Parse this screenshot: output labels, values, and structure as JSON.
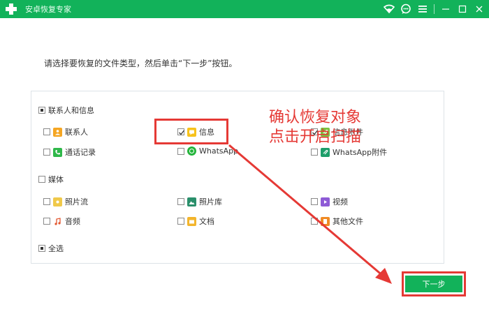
{
  "window": {
    "title": "安卓恢复专家",
    "icons": [
      "wifi-icon",
      "chat-icon",
      "menu-icon",
      "minimize-icon",
      "maximize-icon",
      "close-icon"
    ]
  },
  "instruction": "请选择要恢复的文件类型，然后单击“下一步”按钮。",
  "categories": {
    "contacts_messages": {
      "label": "联系人和信息",
      "state": "partial",
      "items": {
        "contacts": {
          "label": "联系人",
          "checked": false,
          "icon": "contacts-icon"
        },
        "messages": {
          "label": "信息",
          "checked": true,
          "icon": "message-icon"
        },
        "message_attachments": {
          "label": "信息附件",
          "checked": true,
          "icon": "attachment-icon"
        },
        "call_log": {
          "label": "通话记录",
          "checked": false,
          "icon": "phone-icon"
        },
        "whatsapp": {
          "label": "WhatsApp",
          "checked": false,
          "icon": "whatsapp-icon"
        },
        "whatsapp_attachments": {
          "label": "WhatsApp附件",
          "checked": false,
          "icon": "whatsapp-attachment-icon"
        }
      }
    },
    "media": {
      "label": "媒体",
      "state": "unchecked",
      "items": {
        "photo_stream": {
          "label": "照片流",
          "checked": false,
          "icon": "photo-stream-icon"
        },
        "photo_library": {
          "label": "照片库",
          "checked": false,
          "icon": "photo-library-icon"
        },
        "video": {
          "label": "视频",
          "checked": false,
          "icon": "video-icon"
        },
        "audio": {
          "label": "音频",
          "checked": false,
          "icon": "audio-icon"
        },
        "documents": {
          "label": "文档",
          "checked": false,
          "icon": "folder-icon"
        },
        "other_files": {
          "label": "其他文件",
          "checked": false,
          "icon": "other-files-icon"
        }
      }
    },
    "select_all": {
      "label": "全选",
      "state": "partial"
    }
  },
  "annotation": {
    "line1": "确认恢复对象",
    "line2": "点击开启扫描",
    "color": "#e53935"
  },
  "next_button": {
    "label": "下一步"
  },
  "colors": {
    "brand": "#12b25a",
    "annotation": "#e53935"
  }
}
